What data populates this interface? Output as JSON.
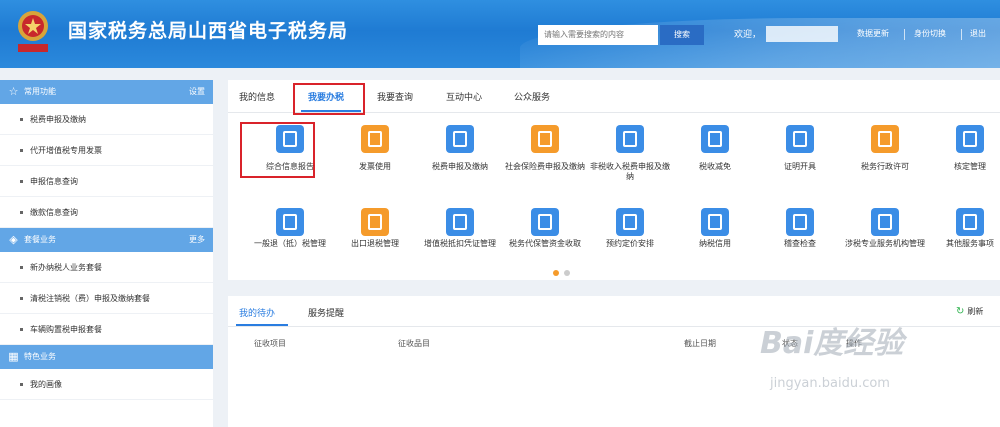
{
  "header": {
    "title": "国家税务总局山西省电子税务局",
    "search_placeholder": "请输入需要搜索的内容",
    "search_label": "搜索",
    "welcome": "欢迎，",
    "links": [
      "数据更新",
      "身份切换",
      "退出"
    ]
  },
  "sidebar": {
    "sections": [
      {
        "title": "常用功能",
        "right": "设置",
        "icon": "star-icon",
        "items": [
          "税费申报及缴纳",
          "代开增值税专用发票",
          "申报信息查询",
          "缴款信息查询"
        ]
      },
      {
        "title": "套餐业务",
        "right": "更多",
        "icon": "layers-icon",
        "items": [
          "新办纳税人业务套餐",
          "清税注销税（费）申报及缴纳套餐",
          "车辆购置税申报套餐"
        ]
      },
      {
        "title": "特色业务",
        "right": "",
        "icon": "grid-icon",
        "items": [
          "我的画像"
        ]
      }
    ]
  },
  "tabs": [
    "我的信息",
    "我要办税",
    "我要查询",
    "互动中心",
    "公众服务"
  ],
  "active_tab": "我要办税",
  "services_row1": [
    {
      "label": "综合信息报告",
      "icon": "clipboard-icon",
      "color": "#3b8de6"
    },
    {
      "label": "发票使用",
      "icon": "invoice-icon",
      "color": "#f59b2b"
    },
    {
      "label": "税费申报及缴纳",
      "icon": "card-icon",
      "color": "#3b8de6"
    },
    {
      "label": "社会保险费申报及缴纳",
      "icon": "calendar-icon",
      "color": "#f59b2b"
    },
    {
      "label": "非税收入税费申报及缴纳",
      "icon": "window-icon",
      "color": "#3b8de6"
    },
    {
      "label": "税收减免",
      "icon": "copy-icon",
      "color": "#3b8de6"
    },
    {
      "label": "证明开具",
      "icon": "edit-icon",
      "color": "#3b8de6"
    },
    {
      "label": "税务行政许可",
      "icon": "shield-icon",
      "color": "#f59b2b"
    },
    {
      "label": "核定管理",
      "icon": "pie-icon",
      "color": "#3b8de6"
    }
  ],
  "services_row2": [
    {
      "label": "一般退（抵）税管理",
      "icon": "doc-icon",
      "color": "#3b8de6"
    },
    {
      "label": "出口退税管理",
      "icon": "gear-icon",
      "color": "#f59b2b"
    },
    {
      "label": "增值税抵扣凭证管理",
      "icon": "yen-doc-icon",
      "color": "#3b8de6"
    },
    {
      "label": "税务代保管资金收取",
      "icon": "wallet-icon",
      "color": "#3b8de6"
    },
    {
      "label": "预约定价安排",
      "icon": "id-card-icon",
      "color": "#3b8de6"
    },
    {
      "label": "纳税信用",
      "icon": "check-icon",
      "color": "#3b8de6"
    },
    {
      "label": "稽查检查",
      "icon": "list-icon",
      "color": "#3b8de6"
    },
    {
      "label": "涉税专业服务机构管理",
      "icon": "briefcase-icon",
      "color": "#3b8de6"
    },
    {
      "label": "其他服务事项",
      "icon": "search-doc-icon",
      "color": "#3b8de6"
    }
  ],
  "pager": {
    "pages": 2,
    "current": 1
  },
  "todo": {
    "tabs": [
      "我的待办",
      "服务提醒"
    ],
    "refresh": "刷新",
    "columns": [
      "征收项目",
      "征收品目",
      "截止日期",
      "状态",
      "操作"
    ]
  },
  "watermark": {
    "line1": "Bai度经验",
    "line2": "jingyan.baidu.com"
  },
  "colors": {
    "primary": "#2a7de0",
    "header": "#1f7bd3",
    "sidebar_section": "#62a6e6",
    "highlight": "#d9232a",
    "accent_orange": "#f59b2b"
  }
}
